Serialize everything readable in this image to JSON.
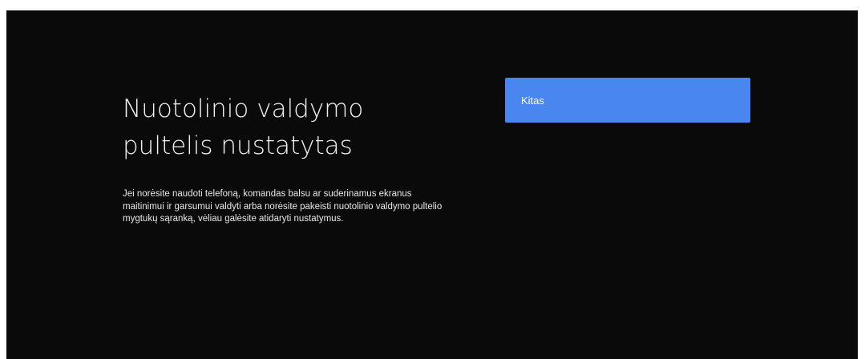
{
  "setup": {
    "title": "Nuotolinio valdymo pultelis nustatytas",
    "description": "Jei norėsite naudoti telefoną, komandas balsu ar suderinamus ekranus maitinimui ir garsumui valdyti arba norėsite pakeisti nuotolinio valdymo pultelio mygtukų sąranką, vėliau galėsite atidaryti nustatymus.",
    "next_button": {
      "label": "Kitas",
      "color": "#4a86f0"
    }
  },
  "colors": {
    "background": "#0a0a0a",
    "text": "#f1f1f1"
  }
}
